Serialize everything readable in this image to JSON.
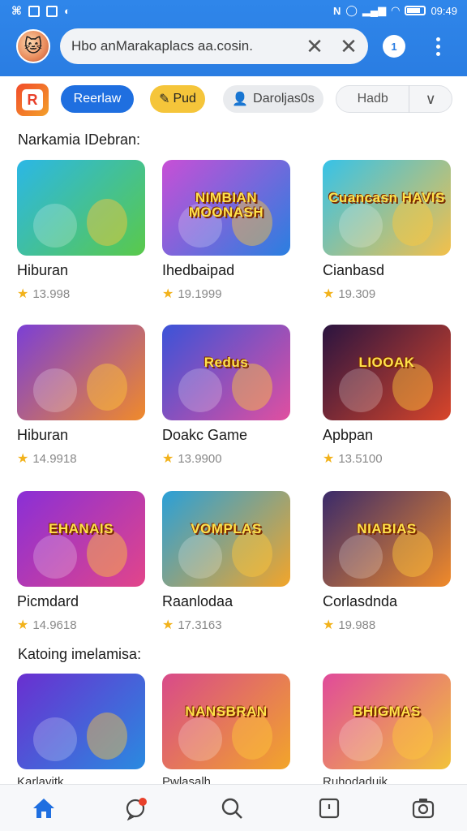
{
  "status_bar": {
    "time": "09:49"
  },
  "header": {
    "search_text": "Hbo anMarakaplacs aa.cosin.",
    "badge": "1"
  },
  "chips": {
    "blue": "Reerlaw",
    "yellow": "Pud",
    "gray": "Daroljas0s",
    "outline": "Hadb"
  },
  "sections": [
    {
      "title": "Narkamia IDebran:"
    },
    {
      "title": "Katoing imelamisa:"
    }
  ],
  "games": [
    {
      "name": "Hiburan",
      "rating": "13.998",
      "thumb_title": "",
      "colors": [
        "#2bb7e6",
        "#5ac94a"
      ]
    },
    {
      "name": "Ihedbaipad",
      "rating": "19.1999",
      "thumb_title": "NIMBIAN MOONASH",
      "colors": [
        "#c84fd6",
        "#2a7fe0"
      ]
    },
    {
      "name": "Cianbasd",
      "rating": "19.309",
      "thumb_title": "Cuancasn HAVIS",
      "colors": [
        "#36c2e8",
        "#f3c04a"
      ]
    },
    {
      "name": "Hiburan",
      "rating": "14.9918",
      "thumb_title": "",
      "colors": [
        "#7b3fd6",
        "#f08a2a"
      ]
    },
    {
      "name": "Doakc Game",
      "rating": "13.9900",
      "thumb_title": "Redus",
      "colors": [
        "#3b53d8",
        "#e04fa0"
      ]
    },
    {
      "name": "Apbpan",
      "rating": "13.5100",
      "thumb_title": "LIOOAK",
      "colors": [
        "#2a1440",
        "#d8452a"
      ]
    },
    {
      "name": "Picmdard",
      "rating": "14.9618",
      "thumb_title": "EHANAIS",
      "colors": [
        "#8a2fd6",
        "#e2458a"
      ]
    },
    {
      "name": "Raanlodaa",
      "rating": "17.3163",
      "thumb_title": "VOMPLAS",
      "colors": [
        "#2aa0d8",
        "#f2a52a"
      ]
    },
    {
      "name": "Corlasdnda",
      "rating": "19.988",
      "thumb_title": "NIABIAS",
      "colors": [
        "#3a2a6a",
        "#f08a2a"
      ]
    },
    {
      "name": "Karlavitk",
      "rating": "",
      "thumb_title": "",
      "colors": [
        "#6a2fd0",
        "#2a8ae0"
      ]
    },
    {
      "name": "Pwlasalh",
      "rating": "",
      "thumb_title": "NANSBRAN",
      "colors": [
        "#d84a8a",
        "#f2a52a"
      ]
    },
    {
      "name": "Ruhodaduik",
      "rating": "",
      "thumb_title": "BHIGMAS",
      "colors": [
        "#e04a9a",
        "#f2c23a"
      ]
    }
  ],
  "bottom_nav": [
    "home-icon",
    "chat-icon",
    "search-icon",
    "doc-icon",
    "camera-icon"
  ],
  "accent": "#2a7de2"
}
